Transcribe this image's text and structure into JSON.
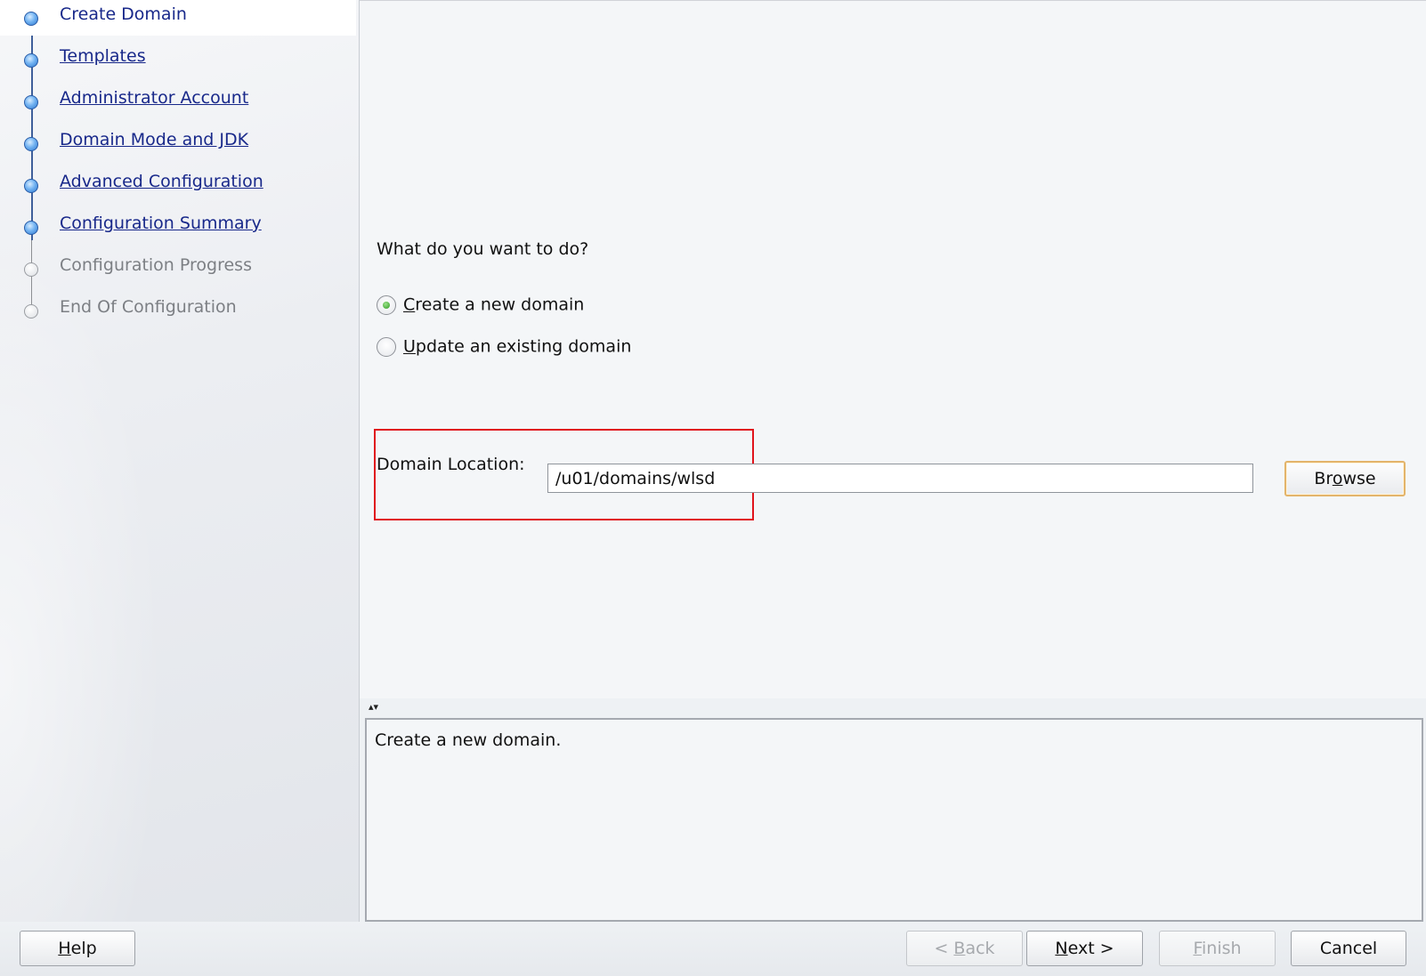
{
  "steps": [
    {
      "label": "Create Domain",
      "state": "current",
      "icon": "step-node-current-icon"
    },
    {
      "label": "Templates",
      "state": "link",
      "icon": "step-node-icon"
    },
    {
      "label": "Administrator Account",
      "state": "link",
      "icon": "step-node-icon"
    },
    {
      "label": "Domain Mode and JDK",
      "state": "link",
      "icon": "step-node-icon"
    },
    {
      "label": "Advanced Configuration",
      "state": "link",
      "icon": "step-node-icon"
    },
    {
      "label": "Configuration Summary",
      "state": "link",
      "icon": "step-node-icon"
    },
    {
      "label": "Configuration Progress",
      "state": "disabled",
      "icon": "step-node-empty-icon"
    },
    {
      "label": "End Of Configuration",
      "state": "disabled",
      "icon": "step-node-empty-icon"
    }
  ],
  "main": {
    "question": "What do you want to do?",
    "options": [
      {
        "mnemonic": "C",
        "rest": "reate a new domain",
        "selected": true
      },
      {
        "mnemonic": "U",
        "rest": "pdate an existing domain",
        "selected": false
      }
    ],
    "domain_location_label": "Domain Location:",
    "domain_location_value": "/u01/domains/wlsd",
    "browse": {
      "pre": "Br",
      "mnemonic": "o",
      "post": "wse"
    }
  },
  "description": "Create a new domain.",
  "footer": {
    "help": {
      "mnemonic": "H",
      "rest": "elp"
    },
    "back": {
      "pre": "< ",
      "mnemonic": "B",
      "rest": "ack",
      "enabled": false
    },
    "next": {
      "mnemonic": "N",
      "rest": "ext >",
      "enabled": true
    },
    "finish": {
      "mnemonic": "F",
      "rest": "inish",
      "enabled": false
    },
    "cancel": "Cancel"
  },
  "colors": {
    "link": "#18288a",
    "highlight_box": "#e0141c",
    "focus_border": "#e3b46a",
    "selected_radio": "#2f9b22"
  }
}
